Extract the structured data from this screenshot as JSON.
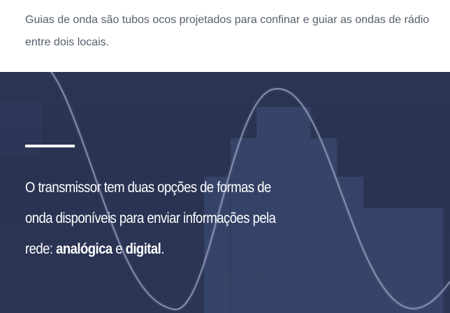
{
  "intro": {
    "text": "Guias de onda são tubos ocos projetados para confinar e guiar as ondas de rádio entre dois locais."
  },
  "banner": {
    "line1": "O transmissor tem duas opções de formas de",
    "line2": "onda disponíveis para enviar informações pela",
    "line3_prefix": "rede: ",
    "analog_label": "analógica",
    "conjunction": " e ",
    "digital_label": "digital",
    "period": ".",
    "background_color": "#2b3453",
    "accent_color": "#ffffff"
  }
}
